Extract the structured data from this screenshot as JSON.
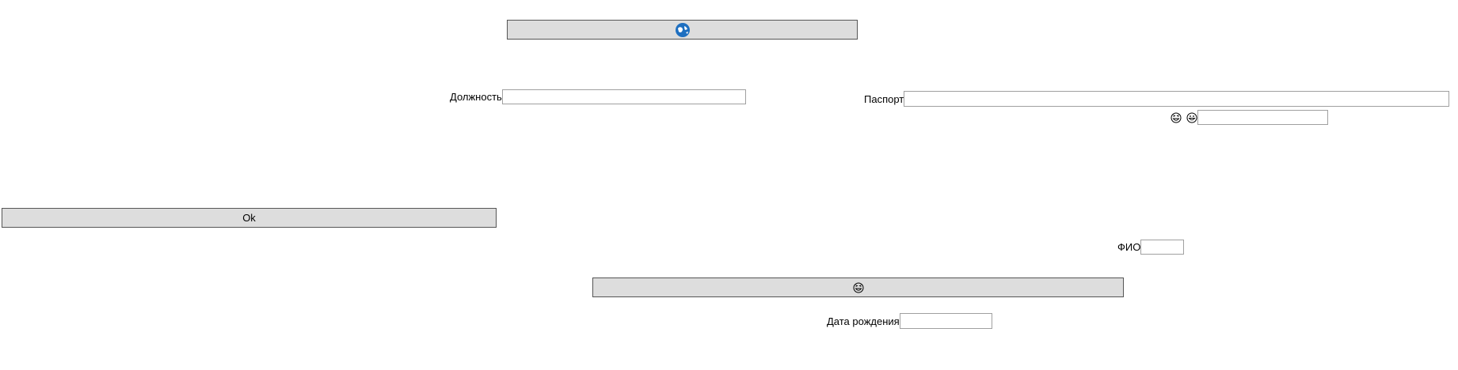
{
  "window": {
    "top_button": {
      "icon": "globe-refresh-icon",
      "label": ""
    },
    "ok_button": {
      "label": "Ok"
    },
    "emoji_button": {
      "icon": "grinning-squint-face-icon",
      "label": ""
    }
  },
  "form": {
    "position": {
      "label": "Должность",
      "value": "",
      "placeholder": ""
    },
    "passport": {
      "label": "Паспорт",
      "value": "",
      "placeholder": ""
    },
    "emoji_field": {
      "icons": [
        "grinning-squint-face-icon",
        "grinning-face-icon"
      ],
      "value": ""
    },
    "full_name": {
      "label": "ФИО",
      "value": "",
      "placeholder": ""
    },
    "birth_date": {
      "label": "Дата рождения",
      "value": "",
      "placeholder": ""
    }
  },
  "colors": {
    "button_bg": "#dddddd",
    "button_border": "#555555",
    "input_border": "#a0a0a0",
    "globe_icon": "#1e6fc0"
  }
}
